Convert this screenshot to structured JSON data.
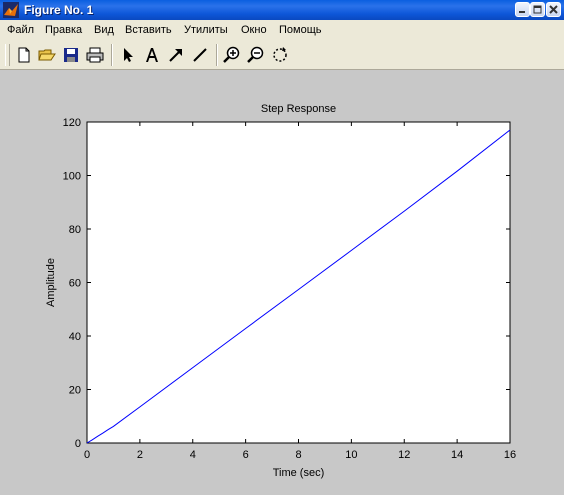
{
  "window": {
    "title": "Figure No. 1"
  },
  "menu": [
    "Файл",
    "Правка",
    "Вид",
    "Вставить",
    "Утилиты",
    "Окно",
    "Помощь"
  ],
  "toolbar": [
    {
      "name": "new-figure-icon"
    },
    {
      "name": "open-file-icon"
    },
    {
      "name": "save-icon"
    },
    {
      "name": "print-icon"
    },
    {
      "name": "select-arrow-icon"
    },
    {
      "name": "insert-text-icon"
    },
    {
      "name": "insert-arrow-icon"
    },
    {
      "name": "insert-line-icon"
    },
    {
      "name": "zoom-in-icon"
    },
    {
      "name": "zoom-out-icon"
    },
    {
      "name": "rotate-3d-icon"
    }
  ],
  "colors": {
    "line": "#0000ff",
    "figure_bg": "#c8c8c8",
    "axes_bg": "#ffffff"
  },
  "chart_data": {
    "type": "line",
    "title": "Step Response",
    "xlabel": "Time (sec)",
    "ylabel": "Amplitude",
    "xlim": [
      0,
      16
    ],
    "ylim": [
      0,
      120
    ],
    "xticks": [
      0,
      2,
      4,
      6,
      8,
      10,
      12,
      14,
      16
    ],
    "yticks": [
      0,
      20,
      40,
      60,
      80,
      100,
      120
    ],
    "grid": false,
    "series": [
      {
        "x": [
          0,
          0.2,
          0.4,
          0.6,
          0.8,
          1,
          2,
          4,
          6,
          8,
          10,
          12,
          14,
          16
        ],
        "y": [
          0,
          1.2,
          2.5,
          3.7,
          5.0,
          6.2,
          13.5,
          28.2,
          42.8,
          57.4,
          72.0,
          86.7,
          101.6,
          117
        ]
      }
    ]
  }
}
